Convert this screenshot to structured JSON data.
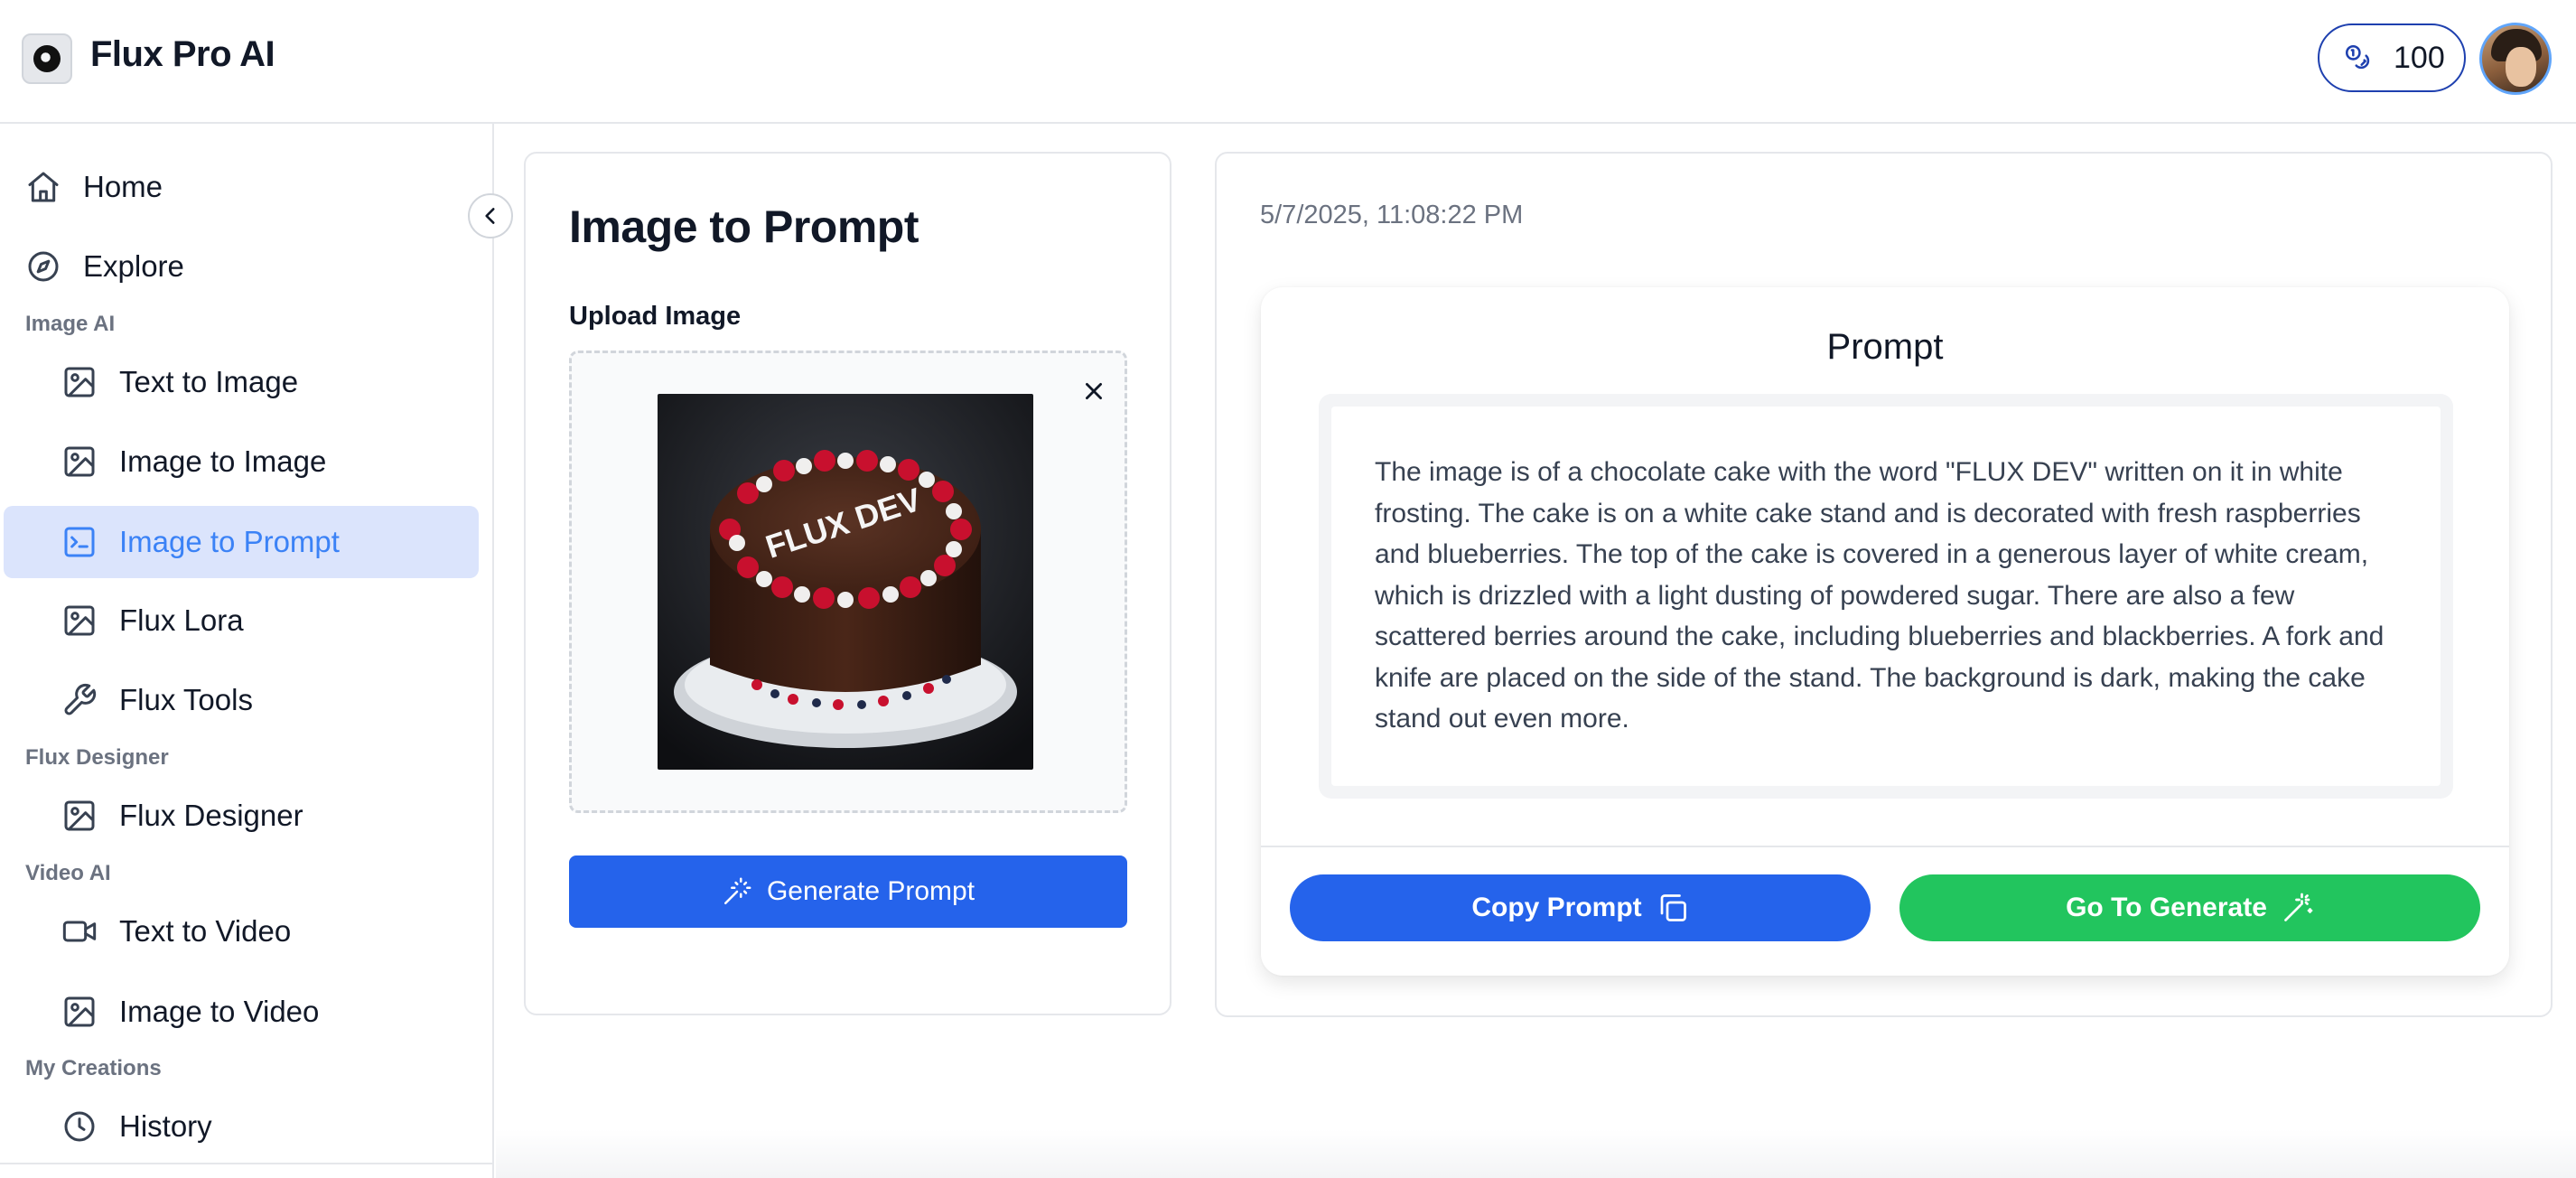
{
  "header": {
    "app_title": "Flux Pro AI",
    "logo_icon": "aperture-logo-icon",
    "credits_icon": "coins-icon",
    "credits": "100",
    "avatar_icon": "user-avatar"
  },
  "sidebar": {
    "collapse_icon": "chevron-left-icon",
    "top_items": [
      {
        "label": "Home",
        "icon": "home-icon"
      },
      {
        "label": "Explore",
        "icon": "compass-icon"
      }
    ],
    "sections": [
      {
        "title": "Image AI",
        "items": [
          {
            "label": "Text to Image",
            "icon": "image-icon"
          },
          {
            "label": "Image to Image",
            "icon": "image-icon"
          },
          {
            "label": "Image to Prompt",
            "icon": "terminal-icon",
            "active": true
          },
          {
            "label": "Flux Lora",
            "icon": "image-icon"
          },
          {
            "label": "Flux Tools",
            "icon": "wrench-icon"
          }
        ]
      },
      {
        "title": "Flux Designer",
        "items": [
          {
            "label": "Flux Designer",
            "icon": "image-icon"
          }
        ]
      },
      {
        "title": "Video AI",
        "items": [
          {
            "label": "Text to Video",
            "icon": "video-icon"
          },
          {
            "label": "Image to Video",
            "icon": "image-icon"
          }
        ]
      },
      {
        "title": "My Creations",
        "items": [
          {
            "label": "History",
            "icon": "clock-icon"
          }
        ]
      }
    ]
  },
  "upload_panel": {
    "title": "Image to Prompt",
    "upload_label": "Upload Image",
    "uploaded_image_text": "FLUX DEV",
    "remove_icon": "close-icon",
    "generate_button": "Generate Prompt",
    "generate_icon": "magic-wand-icon"
  },
  "result_panel": {
    "timestamp": "5/7/2025, 11:08:22 PM",
    "heading": "Prompt",
    "prompt_text": "The image is of a chocolate cake with the word \"FLUX DEV\" written on it in white frosting. The cake is on a white cake stand and is decorated with fresh raspberries and blueberries. The top of the cake is covered in a generous layer of white cream, which is drizzled with a light dusting of powdered sugar. There are also a few scattered berries around the cake, including blueberries and blackberries. A fork and knife are placed on the side of the stand. The background is dark, making the cake stand out even more.",
    "copy_button": "Copy Prompt",
    "copy_icon": "copy-icon",
    "go_button": "Go To Generate",
    "go_icon": "sparkle-wand-icon"
  },
  "colors": {
    "primary": "#2563eb",
    "success": "#22c55e",
    "active_bg": "#dbe4fc",
    "active_text": "#3b82f6",
    "muted": "#6b7280"
  }
}
